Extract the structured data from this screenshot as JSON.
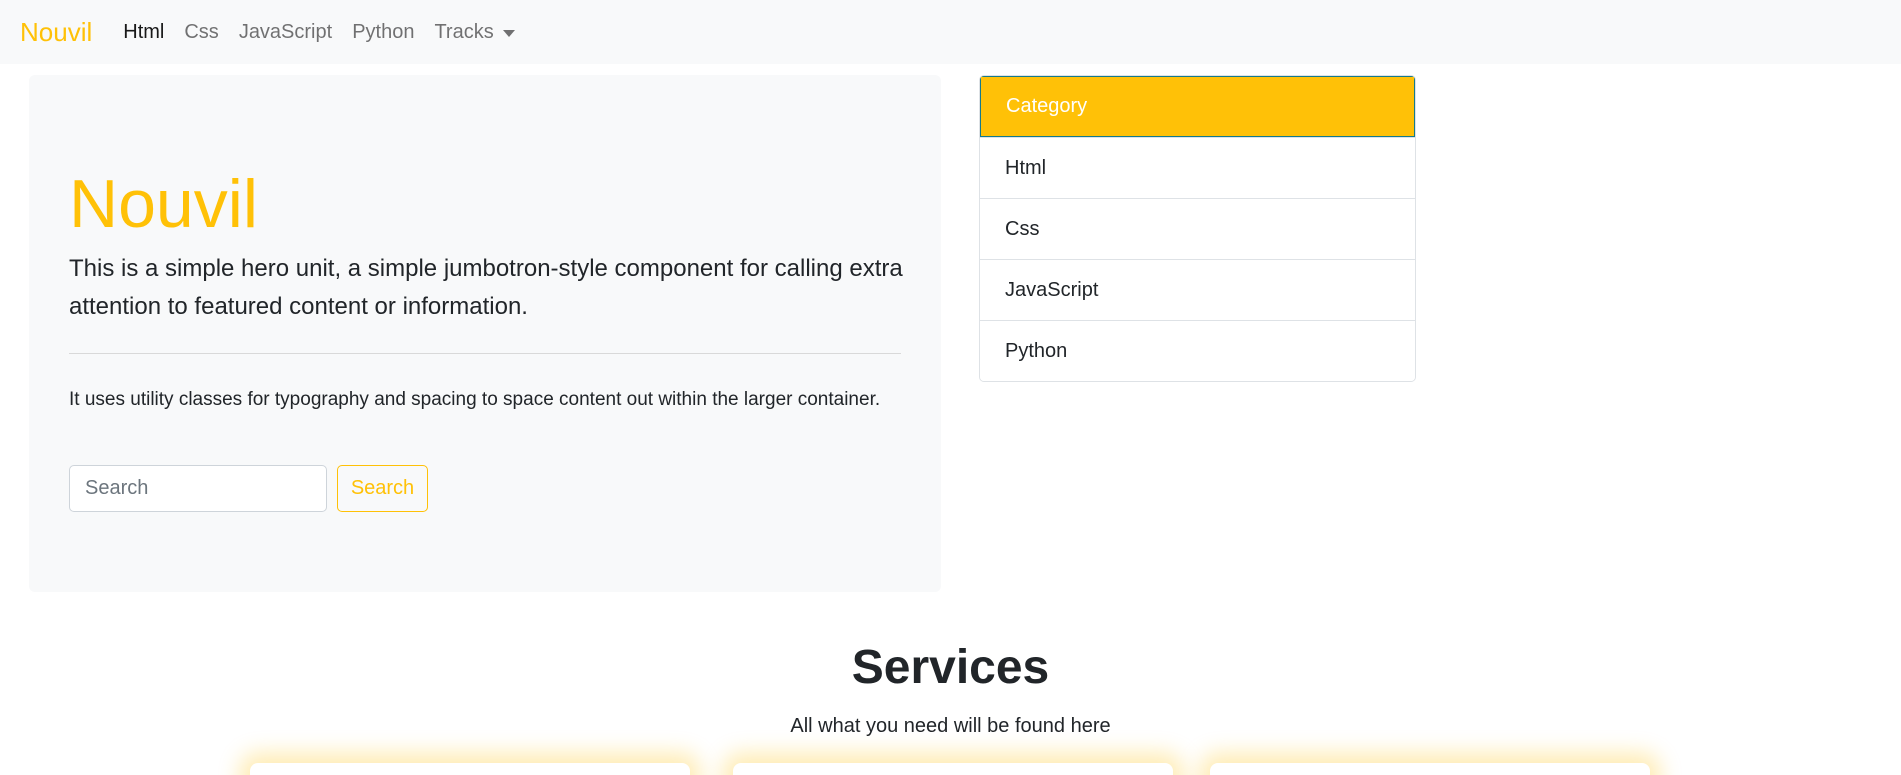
{
  "navbar": {
    "brand": "Nouvil",
    "links": [
      {
        "label": "Html",
        "active": true
      },
      {
        "label": "Css"
      },
      {
        "label": "JavaScript"
      },
      {
        "label": "Python"
      },
      {
        "label": "Tracks"
      }
    ]
  },
  "hero": {
    "title": "Nouvil",
    "lead": "This is a simple hero unit, a simple jumbotron-style component for calling extra attention to featured content or information.",
    "text": "It uses utility classes for typography and spacing to space content out within the larger container.",
    "search_placeholder": "Search",
    "search_button": "Search"
  },
  "category": {
    "header": "Category",
    "items": [
      "Html",
      "Css",
      "JavaScript",
      "Python"
    ]
  },
  "services": {
    "title": "Services",
    "subtitle": "All what you need will be found here"
  },
  "colors": {
    "accent": "#ffc107",
    "navbar_bg": "#f8f9fa",
    "hero_bg": "#f8f9fa"
  }
}
